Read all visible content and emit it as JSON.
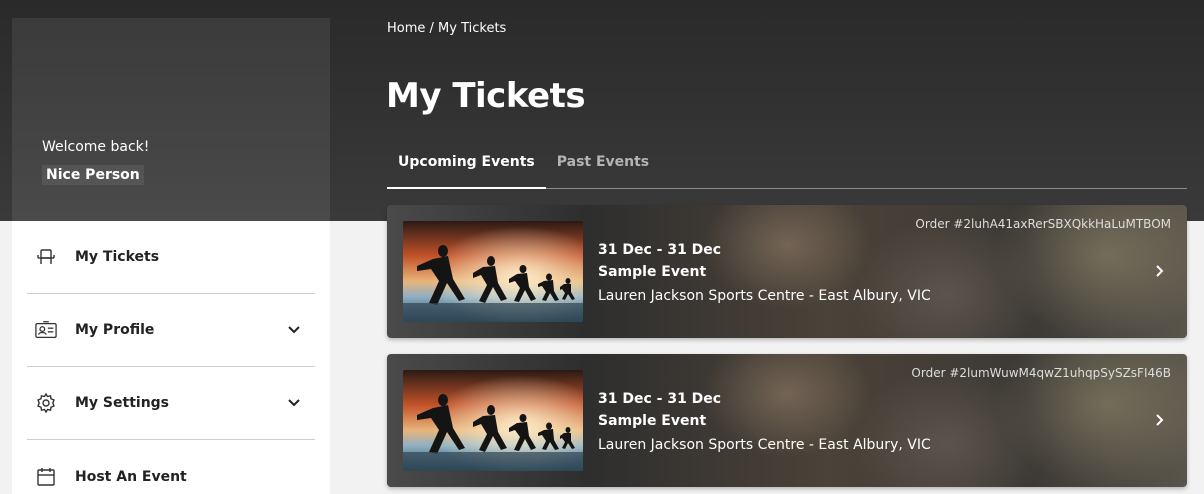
{
  "sidebar": {
    "welcome": "Welcome back!",
    "user_name": "Nice Person",
    "items": [
      {
        "label": "My Tickets",
        "icon": "seat-icon",
        "expandable": false
      },
      {
        "label": "My Profile",
        "icon": "id-card-icon",
        "expandable": true
      },
      {
        "label": "My Settings",
        "icon": "gear-icon",
        "expandable": true
      },
      {
        "label": "Host An Event",
        "icon": "calendar-icon",
        "expandable": false
      }
    ]
  },
  "breadcrumb": {
    "home": "Home",
    "separator": " / ",
    "current": "My Tickets"
  },
  "page_title": "My Tickets",
  "tabs": [
    {
      "label": "Upcoming Events",
      "active": true
    },
    {
      "label": "Past Events",
      "active": false
    }
  ],
  "tickets": [
    {
      "order": "Order #2luhA41axRerSBXQkkHaLuMTBOM",
      "date": "31 Dec - 31 Dec",
      "name": "Sample Event",
      "venue": "Lauren Jackson Sports Centre - East Albury, VIC"
    },
    {
      "order": "Order #2lumWuwM4qwZ1uhqpSySZsFI46B",
      "date": "31 Dec - 31 Dec",
      "name": "Sample Event",
      "venue": "Lauren Jackson Sports Centre - East Albury, VIC"
    }
  ],
  "colors": {
    "hero": "#333333",
    "text_on_dark": "#ffffff",
    "tab_inactive": "#b4b4b4"
  }
}
